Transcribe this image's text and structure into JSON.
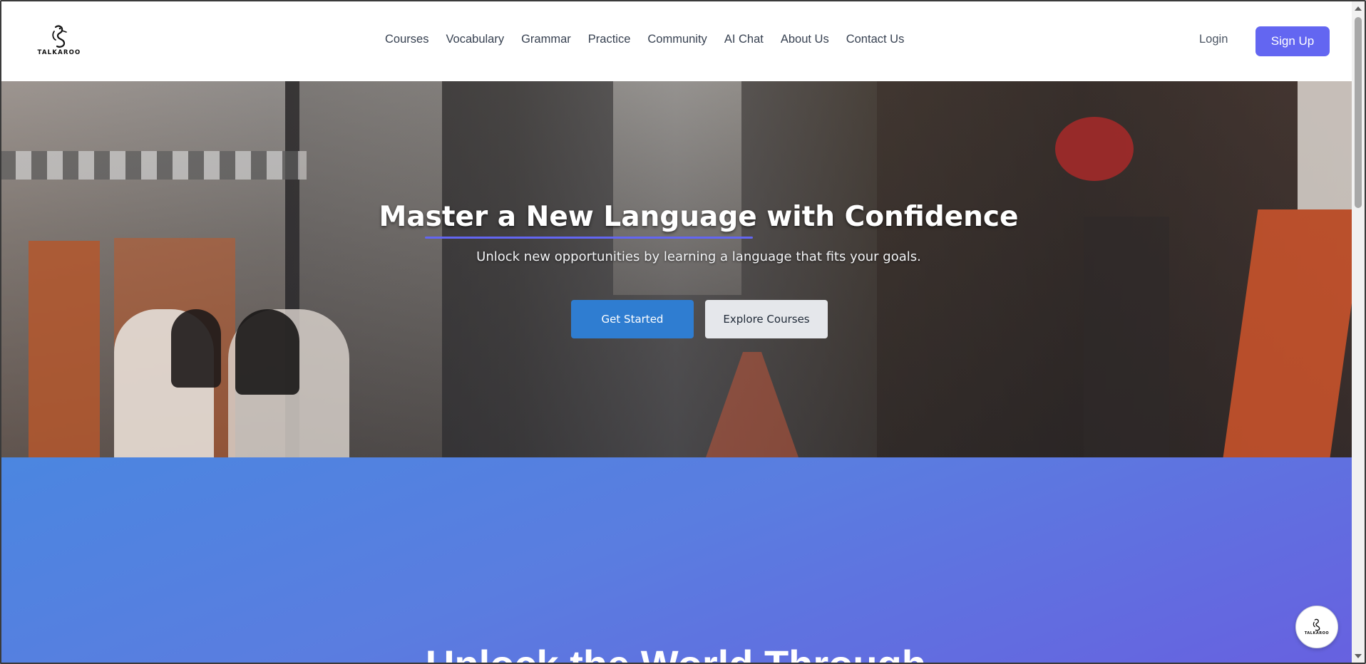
{
  "header": {
    "logo_text": "TALKAROO",
    "nav": [
      "Courses",
      "Vocabulary",
      "Grammar",
      "Practice",
      "Community",
      "AI Chat",
      "About Us",
      "Contact Us"
    ],
    "login_label": "Login",
    "signup_label": "Sign Up"
  },
  "hero": {
    "title": "Master a New Language with Confidence",
    "subtitle": "Unlock new opportunities by learning a language that fits your goals.",
    "get_started_label": "Get Started",
    "explore_label": "Explore Courses"
  },
  "section2": {
    "title": "Unlock the World Through"
  },
  "chat": {
    "logo_text": "TALKAROO"
  },
  "colors": {
    "accent": "#6366f1",
    "primary_button": "#2f7dd1",
    "secondary_button": "#e5e7eb"
  }
}
